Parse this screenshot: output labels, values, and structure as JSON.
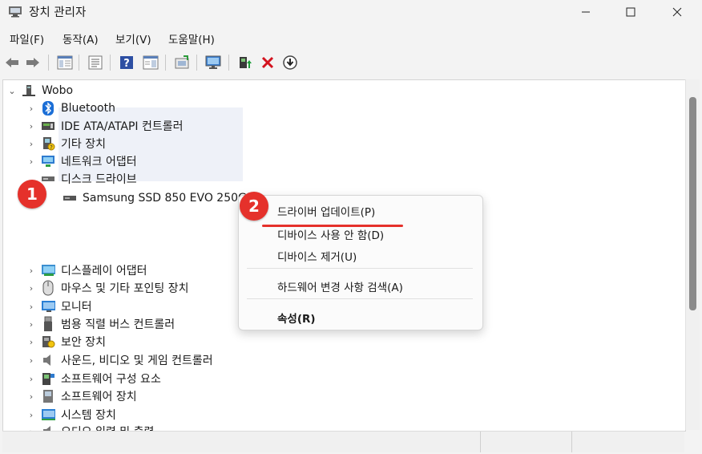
{
  "window": {
    "title": "장치 관리자",
    "controls": {
      "minimize": "—",
      "maximize": "☐",
      "close": "✕"
    }
  },
  "menu": [
    "파일(F)",
    "동작(A)",
    "보기(V)",
    "도움말(H)"
  ],
  "toolbar_icons": [
    "back-arrow-icon",
    "forward-arrow-icon",
    "show-hide-console-tree-icon",
    "properties-icon",
    "help-icon",
    "action-pane-icon",
    "scan-hardware-icon",
    "monitor-icon",
    "update-driver-icon",
    "uninstall-x-icon",
    "disable-device-icon"
  ],
  "tree": {
    "root": "Wobo",
    "items": [
      {
        "label": "Bluetooth",
        "icon": "bluetooth-icon"
      },
      {
        "label": "IDE ATA/ATAPI 컨트롤러",
        "icon": "ide-controller-icon"
      },
      {
        "label": "기타 장치",
        "icon": "other-devices-icon"
      },
      {
        "label": "네트워크 어댑터",
        "icon": "network-adapter-icon"
      },
      {
        "label": "디스크 드라이브",
        "icon": "disk-drive-icon",
        "expanded": true,
        "children": [
          {
            "label": "Samsung SSD 850 EVO 250GB",
            "icon": "ssd-icon",
            "selected": true
          }
        ]
      },
      {
        "label": "디스플레이 어댑터",
        "icon": "display-adapter-icon"
      },
      {
        "label": "마우스 및 기타 포인팅 장치",
        "icon": "mouse-icon"
      },
      {
        "label": "모니터",
        "icon": "monitor-icon"
      },
      {
        "label": "범용 직렬 버스 컨트롤러",
        "icon": "usb-icon"
      },
      {
        "label": "보안 장치",
        "icon": "security-device-icon"
      },
      {
        "label": "사운드, 비디오 및 게임 컨트롤러",
        "icon": "sound-icon"
      },
      {
        "label": "소프트웨어 구성 요소",
        "icon": "software-component-icon"
      },
      {
        "label": "소프트웨어 장치",
        "icon": "software-device-icon"
      },
      {
        "label": "시스템 장치",
        "icon": "system-device-icon"
      },
      {
        "label": "오디오 입력 및 출력",
        "icon": "audio-io-icon"
      }
    ]
  },
  "context_menu": {
    "items": [
      "드라이버 업데이트(P)",
      "디바이스 사용 안 함(D)",
      "디바이스 제거(U)",
      "하드웨어 변경 사항 검색(A)",
      "속성(R)"
    ]
  },
  "annotations": {
    "badge1": "1",
    "badge2": "2"
  },
  "colors": {
    "accent_red": "#e5312b",
    "selection": "#eef1f8"
  }
}
